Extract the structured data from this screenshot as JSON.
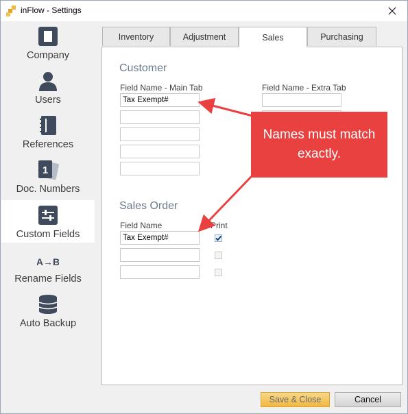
{
  "window": {
    "title": "inFlow - Settings"
  },
  "sidebar": {
    "items": [
      {
        "label": "Company",
        "icon": "building-icon"
      },
      {
        "label": "Users",
        "icon": "user-icon"
      },
      {
        "label": "References",
        "icon": "notebook-icon"
      },
      {
        "label": "Doc. Numbers",
        "icon": "document-number-icon",
        "badge": "1"
      },
      {
        "label": "Custom Fields",
        "icon": "sliders-icon",
        "active": true
      },
      {
        "label": "Rename Fields",
        "icon": "rename-icon",
        "glyph": "A→B"
      },
      {
        "label": "Auto Backup",
        "icon": "database-icon"
      }
    ]
  },
  "tabs": [
    {
      "label": "Inventory"
    },
    {
      "label": "Adjustment"
    },
    {
      "label": "Sales",
      "active": true
    },
    {
      "label": "Purchasing"
    }
  ],
  "customer": {
    "title": "Customer",
    "main_tab_label": "Field Name - Main Tab",
    "extra_tab_label": "Field Name - Extra Tab",
    "main_fields": [
      "Tax Exempt#",
      "",
      "",
      "",
      ""
    ],
    "extra_fields": [
      "",
      ""
    ]
  },
  "sales_order": {
    "title": "Sales Order",
    "field_name_label": "Field Name",
    "print_label": "Print",
    "fields": [
      {
        "value": "Tax Exempt#",
        "print": true
      },
      {
        "value": "",
        "print": false
      },
      {
        "value": "",
        "print": false
      }
    ]
  },
  "callout": {
    "text": "Names must match exactly."
  },
  "buttons": {
    "save_close": "Save & Close",
    "cancel": "Cancel"
  },
  "colors": {
    "callout": "#e94040",
    "section_title": "#6a7a8c",
    "save_button": "#f0b841",
    "active_sidebar": "#ffffff",
    "icon": "#3f4a5c"
  }
}
